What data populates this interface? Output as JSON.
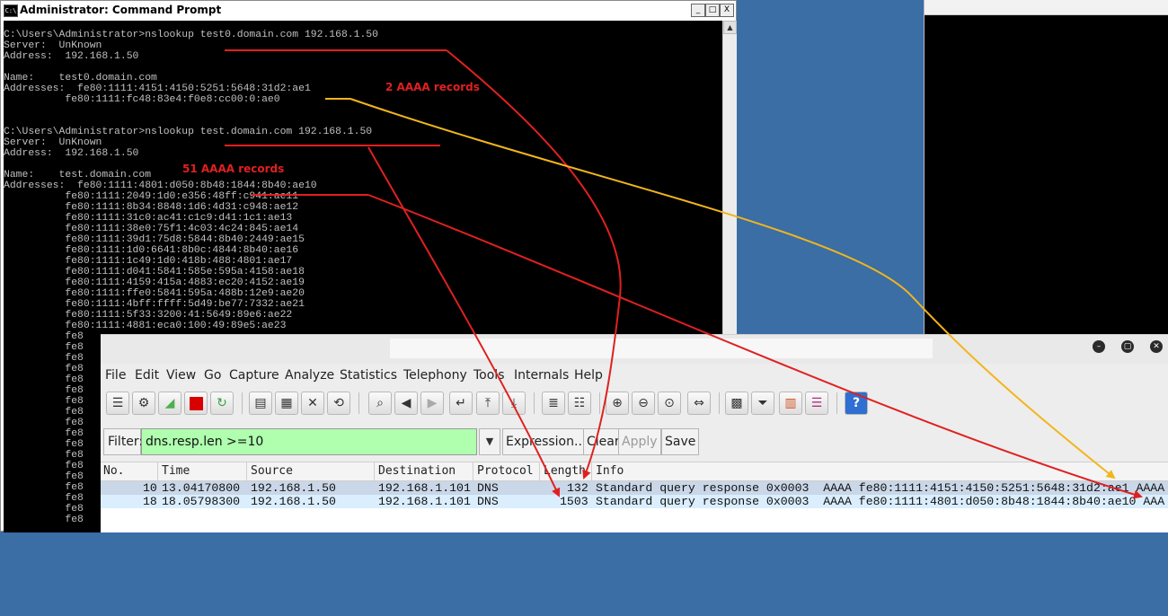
{
  "cmd": {
    "title": "Administrator: Command Prompt",
    "icon_text": "C:\\",
    "buttons": [
      "_",
      "□",
      "X"
    ],
    "lines": [
      "C:\\Users\\Administrator>nslookup test0.domain.com 192.168.1.50",
      "Server:  UnKnown",
      "Address:  192.168.1.50",
      "",
      "Name:    test0.domain.com",
      "Addresses:  fe80:1111:4151:4150:5251:5648:31d2:ae1",
      "          fe80:1111:fc48:83e4:f0e8:cc00:0:ae0",
      "",
      "",
      "C:\\Users\\Administrator>nslookup test.domain.com 192.168.1.50",
      "Server:  UnKnown",
      "Address:  192.168.1.50",
      "",
      "Name:    test.domain.com",
      "Addresses:  fe80:1111:4801:d050:8b48:1844:8b40:ae10",
      "          fe80:1111:2049:1d0:e356:48ff:c941:ae11",
      "          fe80:1111:8b34:8848:1d6:4d31:c948:ae12",
      "          fe80:1111:31c0:ac41:c1c9:d41:1c1:ae13",
      "          fe80:1111:38e0:75f1:4c03:4c24:845:ae14",
      "          fe80:1111:39d1:75d8:5844:8b40:2449:ae15",
      "          fe80:1111:1d0:6641:8b0c:4844:8b40:ae16",
      "          fe80:1111:1c49:1d0:418b:488:4801:ae17",
      "          fe80:1111:d041:5841:585e:595a:4158:ae18",
      "          fe80:1111:4159:415a:4883:ec20:4152:ae19",
      "          fe80:1111:ffe0:5841:595a:488b:12e9:ae20",
      "          fe80:1111:4bff:ffff:5d49:be77:7332:ae21",
      "          fe80:1111:5f33:3200:41:5649:89e6:ae22",
      "          fe80:1111:4881:eca0:100:49:89e5:ae23",
      "          fe8",
      "          fe8",
      "          fe8",
      "          fe8",
      "          fe8",
      "          fe8",
      "          fe8",
      "          fe8",
      "          fe8",
      "          fe8",
      "          fe8",
      "          fe8",
      "          fe8",
      "          fe8",
      "          fe8",
      "          fe8",
      "          fe8",
      "          fe8"
    ]
  },
  "annotations": {
    "note1": "2 AAAA records",
    "note2": "51  AAAA records"
  },
  "wireshark": {
    "window_buttons": [
      "–",
      "▢",
      "✕"
    ],
    "menu": [
      "File",
      "Edit",
      "View",
      "Go",
      "Capture",
      "Analyze",
      "Statistics",
      "Telephony",
      "Tools",
      "Internals",
      "Help"
    ],
    "filter": {
      "label": "Filter:",
      "value": "dns.resp.len >=10",
      "buttons": [
        "Expression...",
        "Clear",
        "Apply",
        "Save"
      ]
    },
    "columns": [
      "No.",
      "Time",
      "Source",
      "Destination",
      "Protocol",
      "Length",
      "Info"
    ],
    "packets": [
      {
        "no": "10",
        "time": "13.04170800",
        "source": "192.168.1.50",
        "destination": "192.168.1.101",
        "protocol": "DNS",
        "length": "132",
        "info": "Standard query response 0x0003  AAAA fe80:1111:4151:4150:5251:5648:31d2:ae1 AAAA"
      },
      {
        "no": "18",
        "time": "18.05798300",
        "source": "192.168.1.50",
        "destination": "192.168.1.101",
        "protocol": "DNS",
        "length": "1503",
        "info": "Standard query response 0x0003  AAAA fe80:1111:4801:d050:8b48:1844:8b40:ae10 AAA"
      }
    ],
    "help_icon": "?"
  },
  "colors": {
    "annotation_red": "#e02020",
    "annotation_yellow": "#f2b51c",
    "filter_ok_green": "#afffaf"
  }
}
